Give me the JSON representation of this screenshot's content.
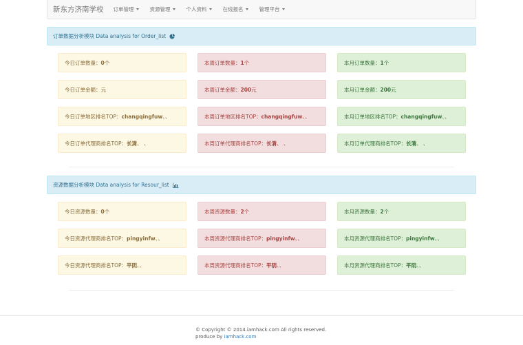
{
  "nav": {
    "brand": "新东方济南学校",
    "items": [
      {
        "label": "订单管理",
        "caret": true
      },
      {
        "label": "资源管理",
        "caret": true
      },
      {
        "label": "个人资料",
        "caret": true
      },
      {
        "label": "在线报名",
        "caret": true
      },
      {
        "label": "管理平台",
        "caret": true
      }
    ]
  },
  "order": {
    "title": "订单数据分析模块 Data analysis for Order_list",
    "icon": "pie-chart-icon",
    "rows": [
      [
        {
          "pre": "今日订单数量：",
          "val": "0",
          "post": " 个"
        },
        {
          "pre": "本周订单数量：",
          "val": "1",
          "post": " 个"
        },
        {
          "pre": "本月订单数量：",
          "val": "1",
          "post": " 个"
        }
      ],
      [
        {
          "pre": "今日订单金额：",
          "val": "",
          "post": " 元"
        },
        {
          "pre": "本周订单金额：",
          "val": "200",
          "post": " 元"
        },
        {
          "pre": "本月订单金额：",
          "val": "200",
          "post": " 元"
        }
      ],
      [
        {
          "pre": "今日订单地区排名TOP：",
          "val": "changqingfuw",
          "post": " 、、"
        },
        {
          "pre": "本周订单地区排名TOP：",
          "val": "changqingfuw",
          "post": " 、、"
        },
        {
          "pre": "本月订单地区排名TOP：",
          "val": "changqingfuw",
          "post": " 、、"
        }
      ],
      [
        {
          "pre": "今日订单代理商排名TOP：",
          "val": "长清",
          "post": "、 、"
        },
        {
          "pre": "本周订单代理商排名TOP：",
          "val": "长清",
          "post": "、 、"
        },
        {
          "pre": "本月订单代理商排名TOP：",
          "val": "长清",
          "post": "、 、"
        }
      ]
    ]
  },
  "resource": {
    "title": "资源数据分析模块 Data analysis for Resour_list",
    "icon": "bar-chart-icon",
    "rows": [
      [
        {
          "pre": "今日资源数量：",
          "val": "0",
          "post": " 个"
        },
        {
          "pre": "本周资源数量：",
          "val": "2",
          "post": " 个"
        },
        {
          "pre": "本月资源数量：",
          "val": "2",
          "post": " 个"
        }
      ],
      [
        {
          "pre": "今日资源代理商排名TOP：",
          "val": "pingyinfw",
          "post": " 、、"
        },
        {
          "pre": "本周资源代理商排名TOP：",
          "val": "pingyinfw",
          "post": " 、、"
        },
        {
          "pre": "本月资源代理商排名TOP：",
          "val": "pingyinfw",
          "post": " 、、"
        }
      ],
      [
        {
          "pre": "今日资源代理商排名TOP：",
          "val": "平阴",
          "post": " 、、"
        },
        {
          "pre": "本周资源代理商排名TOP：",
          "val": "平阴",
          "post": " 、、"
        },
        {
          "pre": "本月资源代理商排名TOP：",
          "val": "平阴",
          "post": " 、、"
        }
      ]
    ]
  },
  "footer": {
    "copyright": "© Copyright © 2014.iamhack.com All rights reserved.",
    "produce_prefix": "produce by ",
    "produce_link": "iamhack.com"
  }
}
